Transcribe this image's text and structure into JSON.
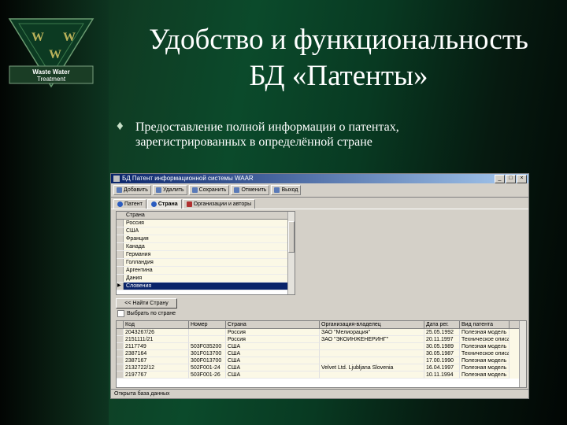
{
  "slide": {
    "title_line1": "Удобство и функциональность",
    "title_line2": "БД «Патенты»",
    "bullet_symbol": "♦",
    "bullet_line1": "Предоставление полной информации о патентах,",
    "bullet_line2": "зарегистрированных в определённой стране"
  },
  "logo": {
    "letters": "W W W",
    "text_line1": "Waste Water",
    "text_line2": "Treatment"
  },
  "app": {
    "title": "БД Патент информационной системы WAAR",
    "toolbar": [
      "Добавить",
      "Удалить",
      "Сохранить",
      "Отменить",
      "Выход"
    ],
    "tabs": [
      "Патент",
      "Страна",
      "Организации и авторы"
    ],
    "country_header": "Страна",
    "countries": [
      "Россия",
      "США",
      "Франция",
      "Канада",
      "Германия",
      "Голландия",
      "Аргентина",
      "Дания",
      "Словения"
    ],
    "selected_country_index": 8,
    "find_button": "<< Найти Страну",
    "checkbox_label": "Выбрать по стране",
    "grid_headers": [
      "Код",
      "Номер",
      "Страна",
      "Организация-владелец",
      "Дата рег.",
      "Вид патента"
    ],
    "grid_rows": [
      [
        "2043267/26",
        "",
        "Россия",
        "ЗАО \"Мелиорация\"",
        "25.05.1992",
        "Полезная модель"
      ],
      [
        "2151111/21",
        "",
        "Россия",
        "ЗАО \"ЭКОИНЖЕНЕРИНГ\"",
        "20.11.1997",
        "Техническое описание"
      ],
      [
        "2117749",
        "503F035200",
        "США",
        "",
        "30.05.1989",
        "Полезная модель"
      ],
      [
        "2387164",
        "301F013700",
        "США",
        "",
        "30.05.1987",
        "Техническое описание"
      ],
      [
        "2387167",
        "300F013700",
        "США",
        "",
        "17.00.1990",
        "Полезная модель"
      ],
      [
        "2132722/12",
        "502F001-24",
        "США",
        "Velvet Ltd. Ljubljana Slovenia",
        "16.04.1997",
        "Полезная модель"
      ],
      [
        "2197767",
        "503F001-26",
        "США",
        "",
        "10.11.1994",
        "Полезная модель"
      ]
    ],
    "statusbar": "Открыта база данных"
  }
}
